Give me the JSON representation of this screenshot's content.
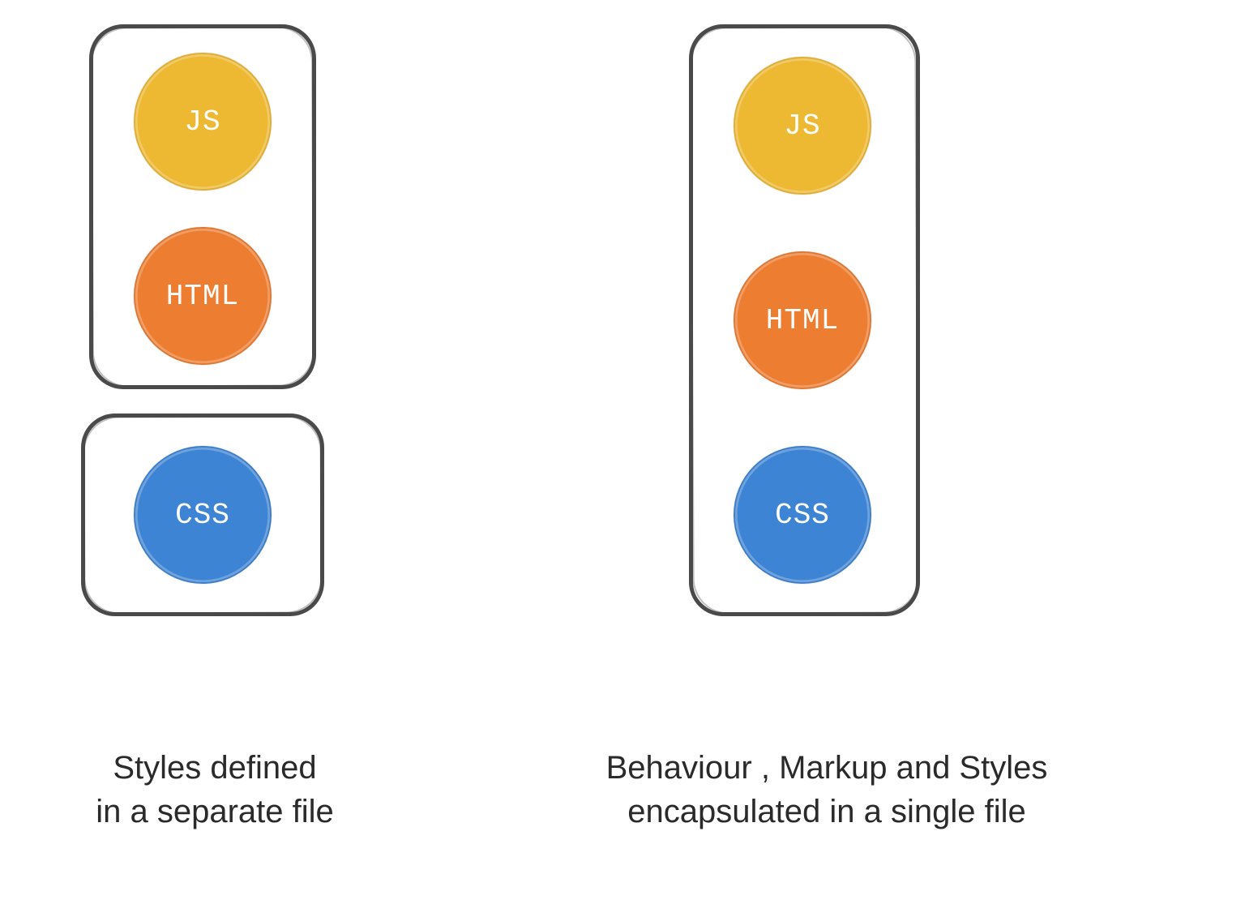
{
  "colors": {
    "js": "#eeb932",
    "html": "#ed7d31",
    "css": "#3e84d4",
    "stroke": "#4a4a4a"
  },
  "left": {
    "circles": {
      "js": "JS",
      "html": "HTML",
      "css": "CSS"
    },
    "caption": "Styles defined\nin a separate file"
  },
  "right": {
    "circles": {
      "js": "JS",
      "html": "HTML",
      "css": "CSS"
    },
    "caption": "Behaviour , Markup and Styles\nencapsulated in a single file"
  }
}
